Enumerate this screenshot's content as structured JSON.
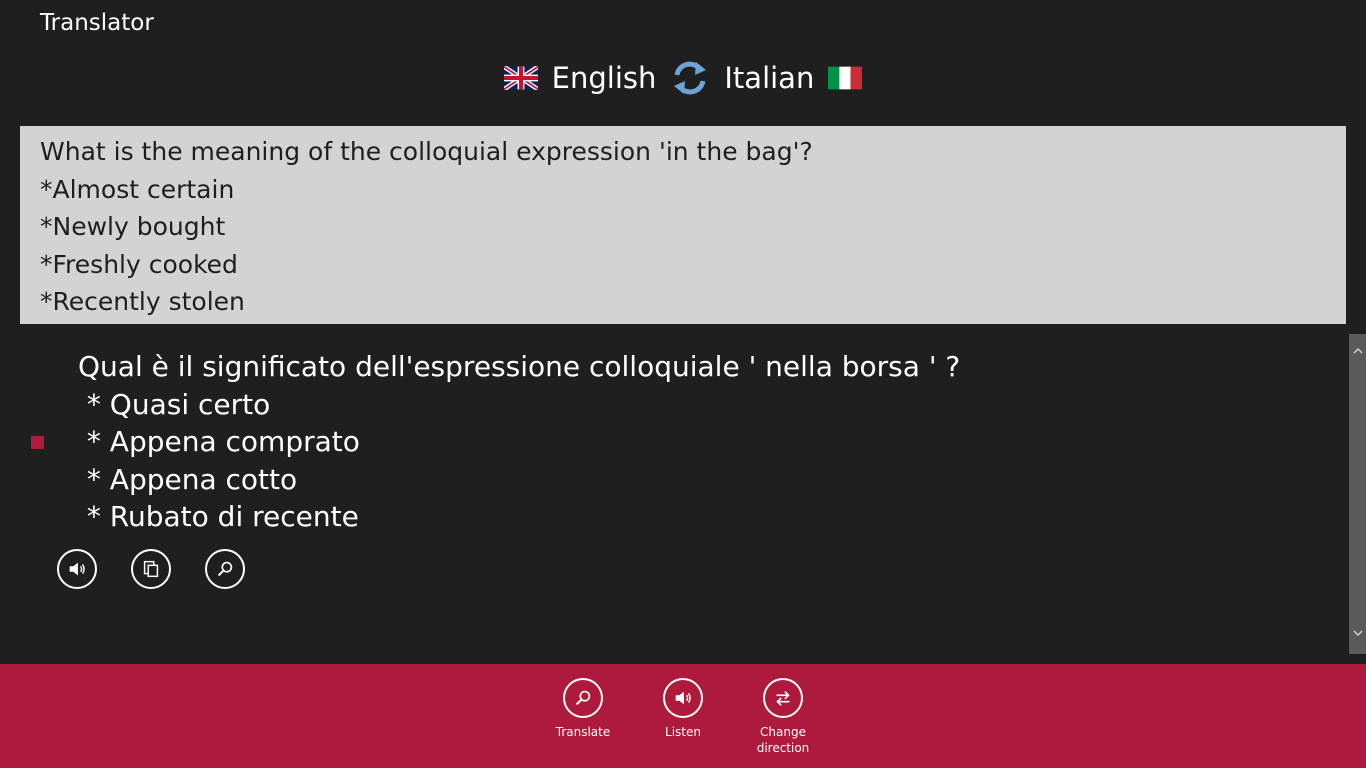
{
  "app": {
    "title": "Translator"
  },
  "languages": {
    "source": "English",
    "target": "Italian",
    "source_flag_icon": "uk-flag-icon",
    "target_flag_icon": "italy-flag-icon",
    "swap_icon": "swap-arrows-icon"
  },
  "source_text": {
    "lines": [
      "What is the meaning of the colloquial expression 'in the bag'?",
      "*Almost certain",
      "*Newly bought",
      "*Freshly cooked",
      "*Recently stolen"
    ]
  },
  "translation": {
    "lines": [
      "Qual è il significato dell'espressione colloquiale ' nella borsa ' ?",
      " * Quasi certo",
      " * Appena comprato",
      " * Appena cotto",
      " * Rubato di recente"
    ],
    "actions": [
      {
        "icon": "speaker-icon"
      },
      {
        "icon": "copy-icon"
      },
      {
        "icon": "search-icon"
      }
    ]
  },
  "app_bar": {
    "commands": [
      {
        "label": "Translate",
        "icon": "search-icon"
      },
      {
        "label": "Listen",
        "icon": "speaker-icon"
      },
      {
        "label": "Change\ndirection",
        "icon": "swap-icon"
      }
    ]
  },
  "colors": {
    "background": "#1f1f1f",
    "source_box": "#d3d3d3",
    "accent": "#ad1a3c",
    "marker": "#b01c3f"
  }
}
